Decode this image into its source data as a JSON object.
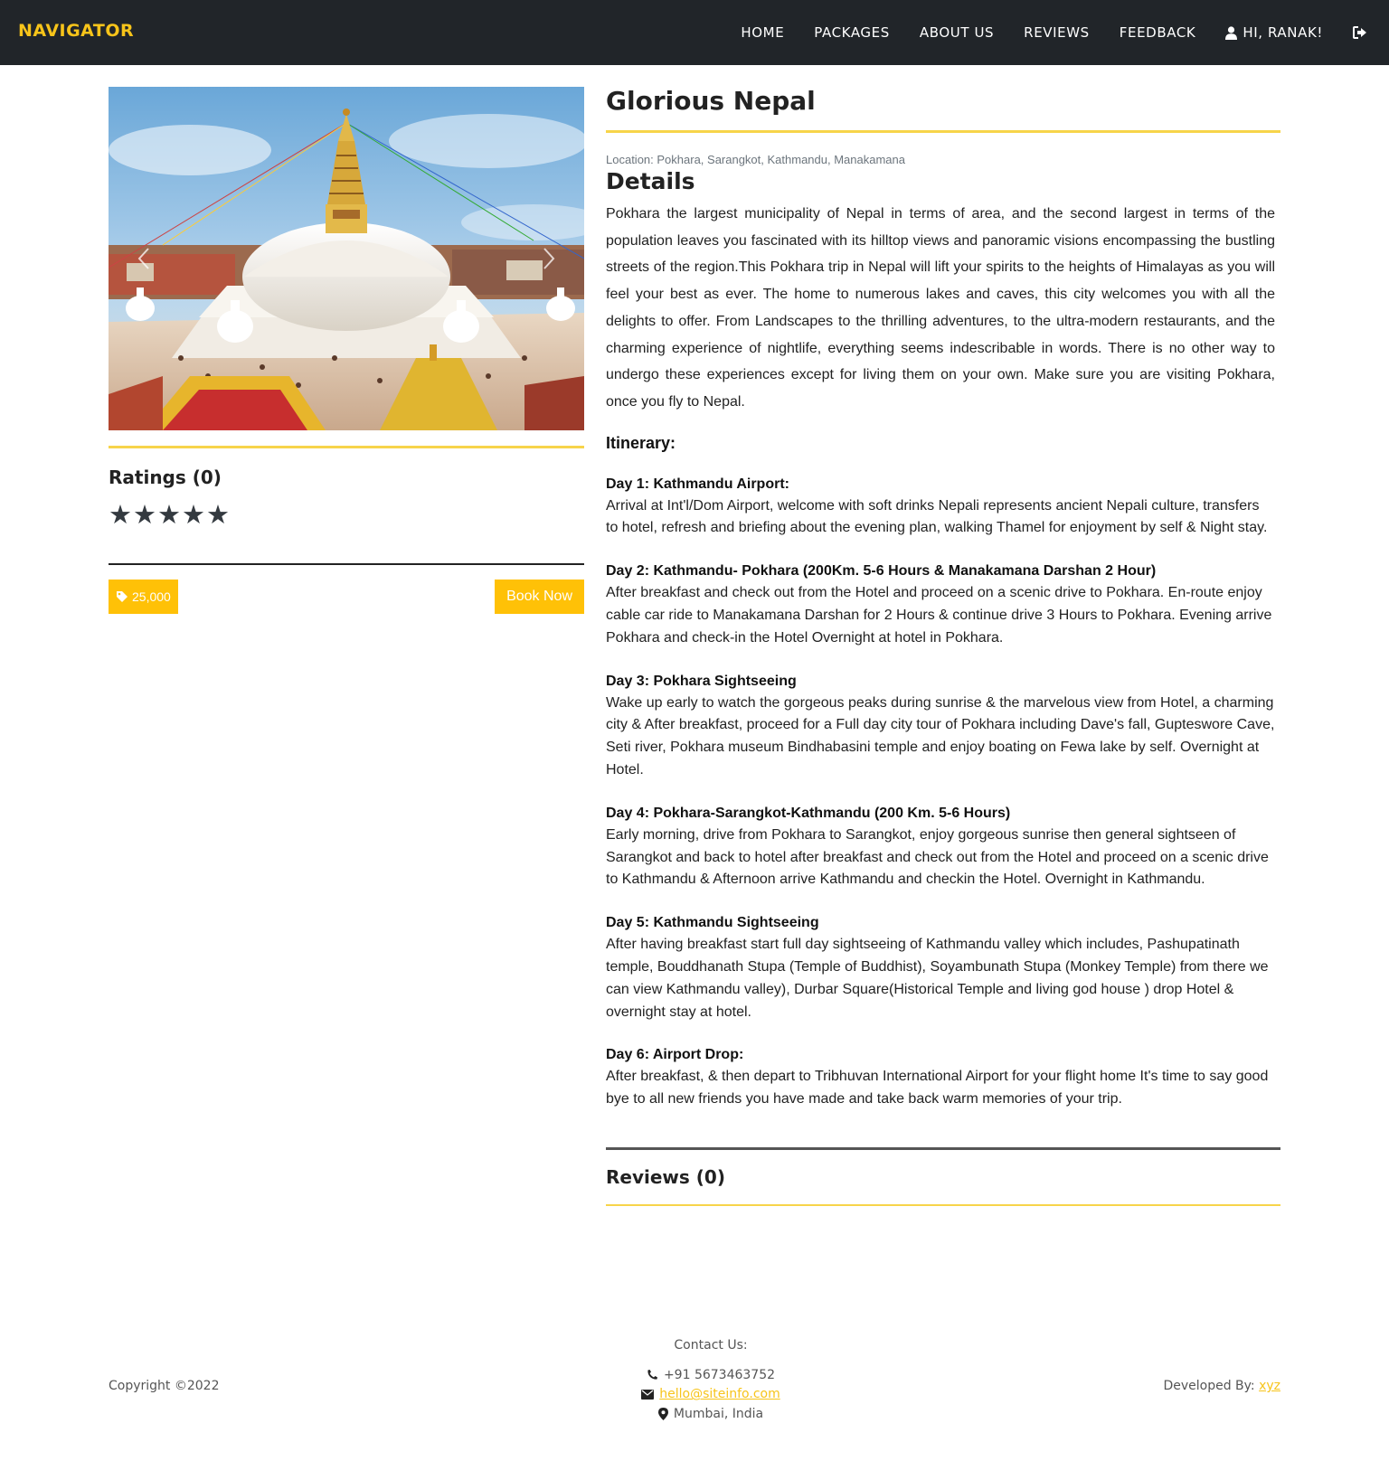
{
  "nav": {
    "brand": "NAVIGATOR",
    "links": [
      "HOME",
      "PACKAGES",
      "ABOUT US",
      "REVIEWS",
      "FEEDBACK"
    ],
    "user_greeting": "HI, RANAK!",
    "icons": {
      "user": "user-icon",
      "logout": "sign-out-icon"
    }
  },
  "package": {
    "title": "Glorious Nepal",
    "location": "Location: Pokhara, Sarangkot, Kathmandu, Manakamana",
    "details_heading": "Details",
    "description": "Pokhara the largest municipality of Nepal in terms of area, and the second largest in terms of the population leaves you fascinated with its hilltop views and panoramic visions encompassing the bustling streets of the region.This Pokhara trip in Nepal will lift your spirits to the heights of Himalayas as you will feel your best as ever. The home to numerous lakes and caves, this city welcomes you with all the delights to offer. From Landscapes to the thrilling adventures, to the ultra-modern restaurants, and the charming experience of nightlife, everything seems indescribable in words. There is no other way to undergo these experiences except for living them on your own. Make sure you are visiting Pokhara, once you fly to Nepal.",
    "itinerary_heading": "Itinerary:",
    "itinerary": [
      {
        "title": "Day 1: Kathmandu Airport:",
        "text": "Arrival at Int'l/Dom Airport, welcome with soft drinks Nepali represents ancient Nepali culture, transfers to hotel, refresh and briefing about the evening plan, walking Thamel for enjoyment by self & Night stay."
      },
      {
        "title": "Day 2: Kathmandu- Pokhara (200Km. 5-6 Hours & Manakamana Darshan 2 Hour)",
        "text": "After breakfast and check out from the Hotel and proceed on a scenic drive  to Pokhara. En-route enjoy cable car ride to Manakamana Darshan for 2 Hours & continue drive 3 Hours to Pokhara. Evening arrive Pokhara and check-in the Hotel Overnight at hotel in Pokhara."
      },
      {
        "title": "Day 3: Pokhara Sightseeing",
        "text": "Wake up early to watch the gorgeous peaks during sunrise & the marvelous view from Hotel, a charming city & After breakfast, proceed for a Full day city tour of Pokhara including Dave's fall, Gupteswore Cave, Seti river, Pokhara museum Bindhabasini temple and enjoy boating on Fewa lake by self. Overnight at Hotel."
      },
      {
        "title": "Day 4: Pokhara-Sarangkot-Kathmandu (200 Km. 5-6 Hours)",
        "text": "Early morning, drive from Pokhara to Sarangkot, enjoy gorgeous sunrise then general sightseen of Sarangkot and back to hotel after breakfast and check out from the Hotel and proceed on a scenic drive to Kathmandu & Afternoon arrive Kathmandu and checkin the Hotel. Overnight in Kathmandu."
      },
      {
        "title": "Day 5: Kathmandu Sightseeing",
        "text": "After having breakfast start full day sightseeing of Kathmandu valley which includes, Pashupatinath temple, Bouddhanath Stupa (Temple of Buddhist), Soyambunath Stupa (Monkey Temple) from there we can view Kathmandu valley), Durbar Square(Historical Temple and living god house ) drop Hotel & overnight stay at hotel."
      },
      {
        "title": "Day 6: Airport Drop:",
        "text": "After breakfast, & then depart to Tribhuvan International Airport for your flight home It's time to say good bye to all new friends you have made and take back warm memories of your trip."
      }
    ],
    "reviews_title": "Reviews (0)"
  },
  "sidebar": {
    "ratings_title": "Ratings (0)",
    "stars_filled": 5,
    "stars_total": 5,
    "price": "25,000",
    "book_label": "Book Now",
    "carousel_image": "Boudhanath stupa panorama, Kathmandu"
  },
  "footer": {
    "copyright": "Copyright ©2022",
    "contact_heading": "Contact Us:",
    "phone": "+91 5673463752",
    "email": "hello@siteinfo.com",
    "address": "Mumbai, India",
    "developed_by_label": "Developed By: ",
    "developer": "xyz"
  },
  "colors": {
    "accent": "#ffc107",
    "brand": "#f7c41a",
    "navbar": "#212529",
    "underline": "#f7d44a"
  }
}
